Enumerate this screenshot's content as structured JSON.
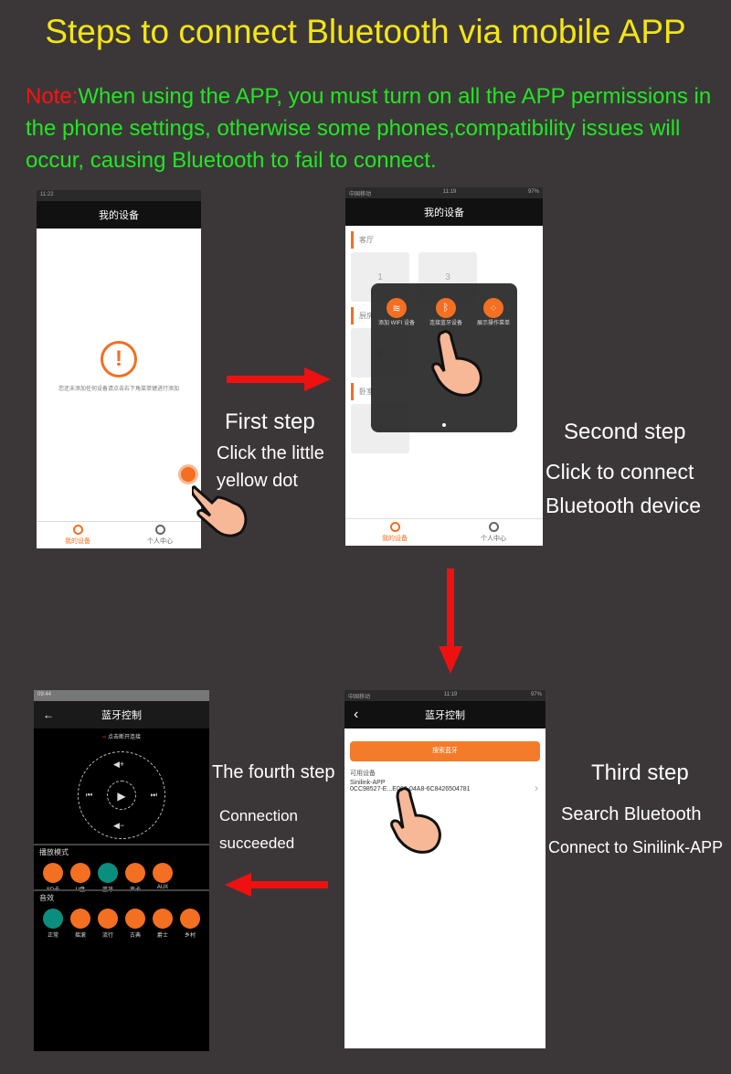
{
  "title": "Steps to connect Bluetooth via mobile APP",
  "note": {
    "label": "Note:",
    "text": "When using the APP, you must turn on all the APP permissions in the phone settings, otherwise some phones,compatibility issues will occur, causing Bluetooth to fail to connect."
  },
  "colors": {
    "title": "#f4e512",
    "note_label": "#ff1111",
    "note_text": "#22e622",
    "accent": "#f36f21",
    "arrow": "#ee1111"
  },
  "steps": {
    "first": {
      "title": "First step",
      "line1": "Click the little",
      "line2": "yellow dot"
    },
    "second": {
      "title": "Second step",
      "line1": "Click to connect",
      "line2": "Bluetooth device"
    },
    "third": {
      "title": "Third step",
      "line1": "Search Bluetooth",
      "line2": "Connect to Sinilink-APP"
    },
    "fourth": {
      "title": "The fourth step",
      "line1": "Connection",
      "line2": "succeeded"
    }
  },
  "phone1": {
    "status_time": "11:22",
    "header": "我的设备",
    "empty_message": "您还未添加任何设备请点击右下角菜单键进行添加",
    "tabs": [
      "我的设备",
      "个人中心"
    ]
  },
  "phone2": {
    "status_carrier": "中国移动",
    "status_time": "11:19",
    "status_battery": "97%",
    "header": "我的设备",
    "groups": [
      {
        "name": "客厅",
        "cards": [
          "1",
          "3"
        ]
      },
      {
        "name": "厨房",
        "cards": [
          "2"
        ]
      },
      {
        "name": "卧室",
        "cards": [
          "4"
        ]
      }
    ],
    "menu": [
      "添加 WIFI 设备",
      "连接蓝牙设备",
      "展示操作菜单"
    ],
    "tabs": [
      "我的设备",
      "个人中心"
    ]
  },
  "phone3": {
    "status_carrier": "中国移动",
    "status_time": "11:19",
    "status_battery": "97%",
    "header": "蓝牙控制",
    "search_button": "搜索蓝牙",
    "section": "可用设备",
    "device_name": "Sinilink-APP",
    "device_id": "0CC98527-E...E062-04A8-6C8426504781"
  },
  "phone4": {
    "status_time": "09:44",
    "header": "蓝牙控制",
    "disconnect": "点击断开连接",
    "play_mode_title": "播放模式",
    "play_modes": [
      "SD卡",
      "U盘",
      "蓝牙",
      "声卡",
      "AUX"
    ],
    "effects_title": "音效",
    "effects": [
      "正常",
      "摇滚",
      "流行",
      "古典",
      "爵士",
      "乡村"
    ]
  }
}
